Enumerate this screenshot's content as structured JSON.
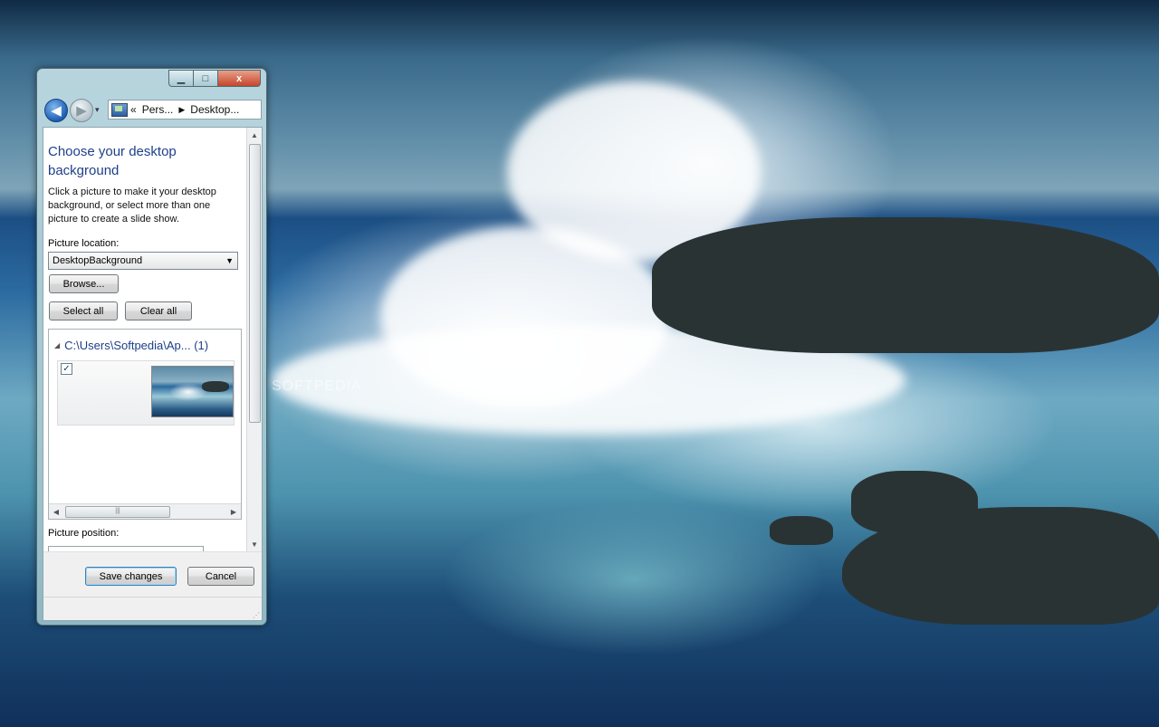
{
  "window": {
    "caption_buttons": {
      "minimize": "▁",
      "maximize": "□",
      "close": "x"
    },
    "nav": {
      "back_icon": "◀",
      "forward_icon": "▶",
      "history_icon": "▾",
      "breadcrumb": {
        "overflow": "«",
        "items": [
          "Pers...",
          "Desktop..."
        ],
        "separator": "▶"
      }
    },
    "heading": "Choose your desktop background",
    "description": "Click a picture to make it your desktop background, or select more than one picture to create a slide show.",
    "picture_location": {
      "label": "Picture location:",
      "selected": "DesktopBackground",
      "dropdown_icon": "▼"
    },
    "buttons": {
      "browse": "Browse...",
      "select_all": "Select all",
      "clear_all": "Clear all"
    },
    "gallery": {
      "group_header": "C:\\Users\\Softpedia\\Ap... (1)",
      "group_collapse_icon": "◢",
      "items": [
        {
          "checked": true,
          "check_mark": "✓"
        }
      ],
      "hscroll_grip": "|||"
    },
    "picture_position": {
      "label": "Picture position:"
    },
    "footer": {
      "save_changes": "Save changes",
      "cancel": "Cancel"
    }
  },
  "desktop": {
    "watermark": "SOFTPEDIA"
  },
  "colors": {
    "heading": "#1e3f8a",
    "accent": "#3c7fb1"
  }
}
